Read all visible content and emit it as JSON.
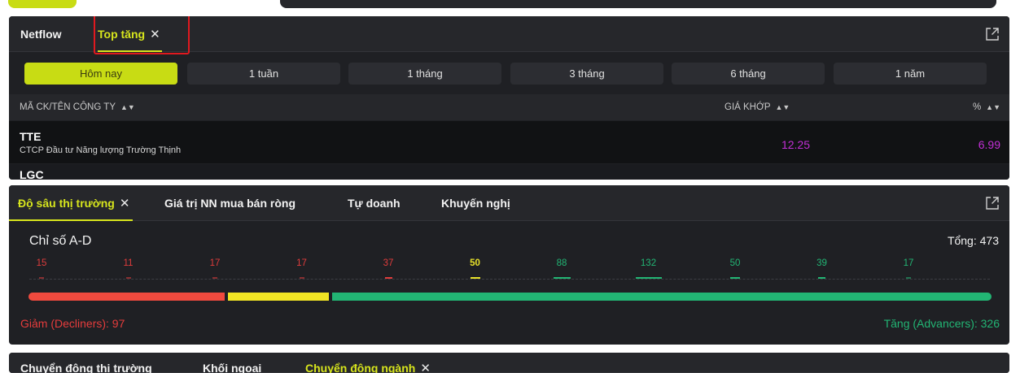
{
  "panel1": {
    "tabs": [
      {
        "label": "Netflow",
        "active": false
      },
      {
        "label": "Top tăng",
        "active": true,
        "closable": true
      }
    ],
    "periods": [
      "Hôm nay",
      "1 tuần",
      "1 tháng",
      "3 tháng",
      "6 tháng",
      "1 năm"
    ],
    "active_period": "Hôm nay",
    "columns": {
      "symbol": "MÃ CK/TÊN CÔNG TY",
      "price": "GIÁ KHỚP",
      "percent": "%"
    },
    "rows": [
      {
        "symbol": "TTE",
        "company": "CTCP Đầu tư Năng lượng Trường Thịnh",
        "price": "12.25",
        "percent": "6.99"
      },
      {
        "symbol": "LGC",
        "company": "",
        "price": "",
        "percent": ""
      }
    ]
  },
  "panel2": {
    "tabs": [
      {
        "label": "Độ sâu thị trường",
        "active": true,
        "closable": true
      },
      {
        "label": "Giá trị NN mua bán ròng",
        "active": false
      },
      {
        "label": "Tự doanh",
        "active": false
      },
      {
        "label": "Khuyến nghị",
        "active": false
      }
    ],
    "title": "Chỉ số A-D",
    "total": "Tổng: 473",
    "buckets": [
      {
        "count": "15",
        "color": "#e03c3c"
      },
      {
        "count": "11",
        "color": "#e03c3c"
      },
      {
        "count": "17",
        "color": "#e03c3c"
      },
      {
        "count": "17",
        "color": "#e03c3c"
      },
      {
        "count": "37",
        "color": "#e03c3c"
      },
      {
        "count": "50",
        "color": "#e8e22a"
      },
      {
        "count": "88",
        "color": "#22b574"
      },
      {
        "count": "132",
        "color": "#22b574"
      },
      {
        "count": "50",
        "color": "#22b574"
      },
      {
        "count": "39",
        "color": "#22b574"
      },
      {
        "count": "17",
        "color": "#22b574"
      }
    ],
    "decliners_label": "Giảm (Decliners): 97",
    "advancers_label": "Tăng (Advancers): 326",
    "decliners": 97,
    "unchanged": 50,
    "advancers": 326,
    "colors": {
      "decline": "#f04a3e",
      "unchanged": "#f2e624",
      "advance": "#22b574"
    }
  },
  "panel3": {
    "tabs": [
      {
        "label": "Chuyển động thị trường",
        "active": false
      },
      {
        "label": "Khối ngoại",
        "active": false
      },
      {
        "label": "Chuyển động ngành",
        "active": true,
        "closable": true
      }
    ]
  },
  "icons": {
    "close": "close-icon",
    "expand": "external-link-icon",
    "sort": "sort-icon"
  },
  "accent": "#c8dc14"
}
